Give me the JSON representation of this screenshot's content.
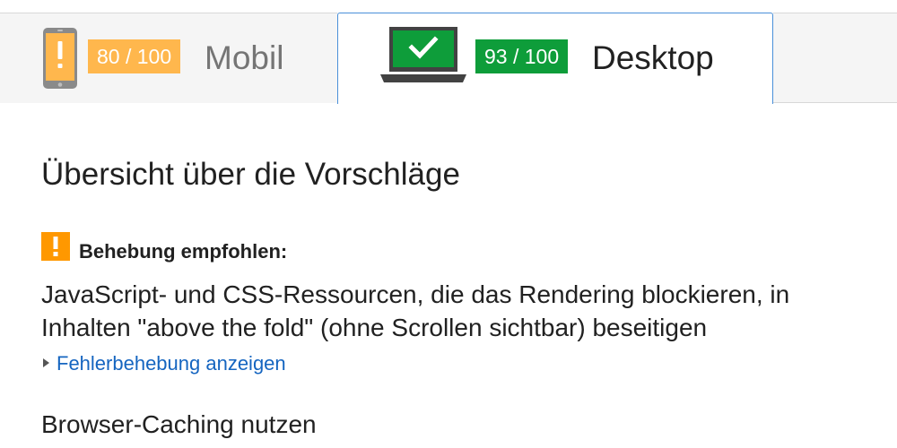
{
  "tabs": {
    "mobile": {
      "score": "80 / 100",
      "label": "Mobil",
      "icon": "phone-warning-icon",
      "score_color": "#ffb74d",
      "active": false
    },
    "desktop": {
      "score": "93 / 100",
      "label": "Desktop",
      "icon": "laptop-check-icon",
      "score_color": "#0e9d3a",
      "active": true
    }
  },
  "summary": {
    "title": "Übersicht über die Vorschläge",
    "recommendation": {
      "icon": "warning-icon",
      "icon_color": "#ff9800",
      "heading": "Behebung empfohlen:",
      "rule_line1": "JavaScript- und CSS-Ressourcen, die das Rendering blockieren, in",
      "rule_line2": "Inhalten \"above the fold\" (ohne Scrollen sichtbar) beseitigen",
      "toggle_label": "Fehlerbehebung anzeigen",
      "link_color": "#1565c0"
    },
    "next_rule": "Browser-Caching nutzen"
  }
}
